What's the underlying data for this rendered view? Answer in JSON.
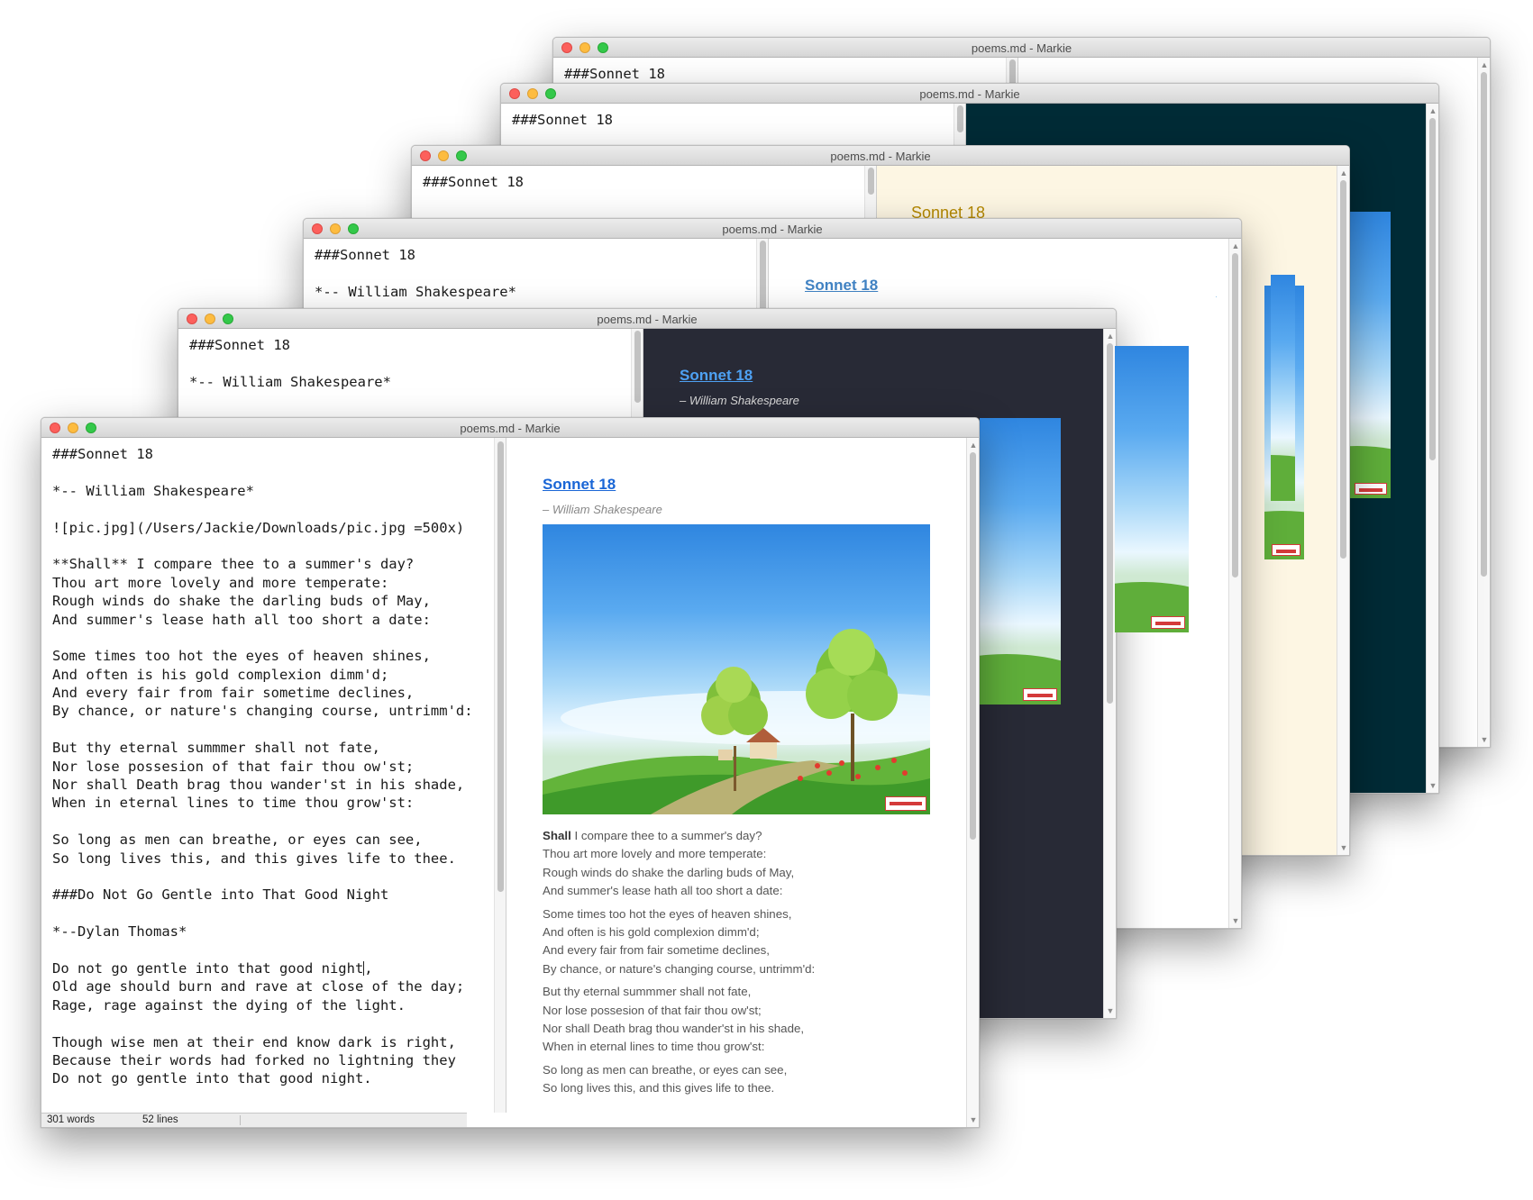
{
  "window_title": "poems.md - Markie",
  "editor_lines": [
    "###Sonnet 18",
    "",
    "*-- William Shakespeare*",
    "",
    "![pic.jpg](/Users/Jackie/Downloads/pic.jpg =500x)",
    "",
    "**Shall** I compare thee to a summer's day?",
    "Thou art more lovely and more temperate:",
    "Rough winds do shake the darling buds of May,",
    "And summer's lease hath all too short a date:",
    "",
    "Some times too hot the eyes of heaven shines,",
    "And often is his gold complexion dimm'd;",
    "And every fair from fair sometime declines,",
    "By chance, or nature's changing course, untrimm'd:",
    "",
    "But thy eternal summmer shall not fate,",
    "Nor lose possesion of that fair thou ow'st;",
    "Nor shall Death brag thou wander'st in his shade,",
    "When in eternal lines to time thou grow'st:",
    "",
    "So long as men can breathe, or eyes can see,",
    "So long lives this, and this gives life to thee.",
    "",
    "###Do Not Go Gentle into That Good Night",
    "",
    "*--Dylan Thomas*",
    "",
    "Do not go gentle into that good night",
    "Old age should burn and rave at close of the day;",
    "Rage, rage against the dying of the light.",
    "",
    "Though wise men at their end know dark is right,",
    "Because their words had forked no lightning they",
    "Do not go gentle into that good night."
  ],
  "cursor_after": ",",
  "preview": {
    "title": "Sonnet 18",
    "author": "– William Shakespeare",
    "stanzas": [
      {
        "bold": "Shall",
        "first": " I compare thee to a summer's day?",
        "lines": [
          "Thou art more lovely and more temperate:",
          "Rough winds do shake the darling buds of May,",
          "And summer's lease hath all too short a date:"
        ]
      },
      {
        "bold": "",
        "first": "Some times too hot the eyes of heaven shines,",
        "lines": [
          "And often is his gold complexion dimm'd;",
          "And every fair from fair sometime declines,",
          "By chance, or nature's changing course, untrimm'd:"
        ]
      },
      {
        "bold": "",
        "first": "But thy eternal summmer shall not fate,",
        "lines": [
          "Nor lose possesion of that fair thou ow'st;",
          "Nor shall Death brag thou wander'st in his shade,",
          "When in eternal lines to time thou grow'st:"
        ]
      },
      {
        "bold": "",
        "first": "So long as men can breathe, or eyes can see,",
        "lines": [
          "So long lives this, and this gives life to thee."
        ]
      }
    ]
  },
  "status": {
    "words": "301 words",
    "lines": "52 lines"
  },
  "fragments": {
    "colon_d": "d:",
    "colon_d_bold": "d:"
  },
  "themes": {
    "solarized_dark_bg": "#002b36",
    "solarized_light_bg": "#fdf6e3",
    "solarized_light_title": "#b58900",
    "dark_bg": "#282a36",
    "dark_title": "#4ea1f3",
    "github_title": "#4183c4",
    "light_title": "#1a66d6"
  }
}
